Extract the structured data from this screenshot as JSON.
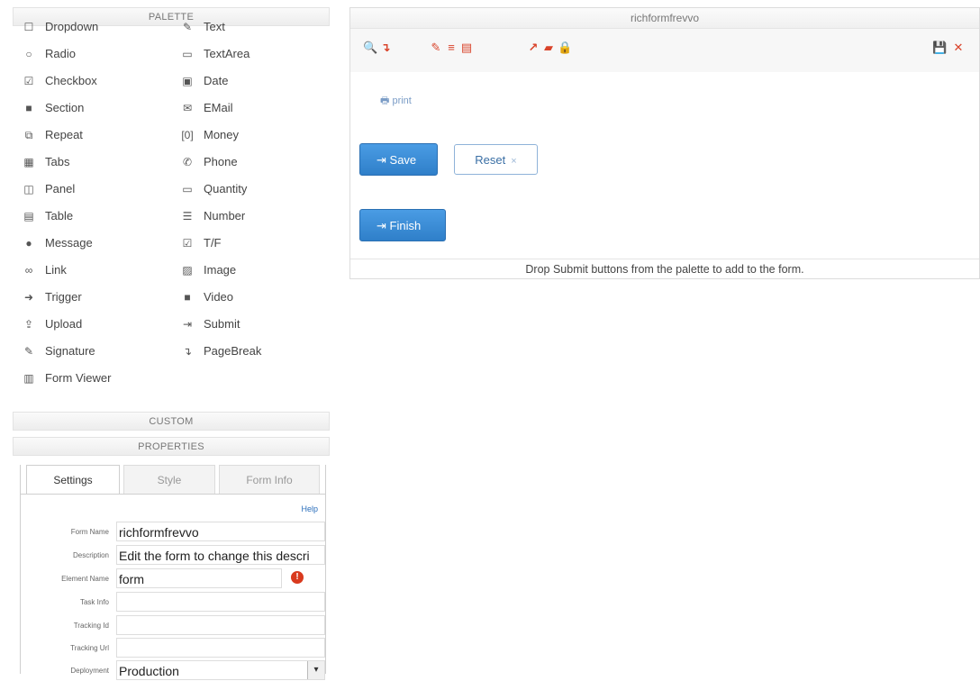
{
  "palette": {
    "header": "PALETTE",
    "left_items": [
      {
        "label": "Dropdown",
        "icon": "☐"
      },
      {
        "label": "Radio",
        "icon": "○"
      },
      {
        "label": "Checkbox",
        "icon": "☑"
      },
      {
        "label": "Section",
        "icon": "■"
      },
      {
        "label": "Repeat",
        "icon": "⧉"
      },
      {
        "label": "Tabs",
        "icon": "▦"
      },
      {
        "label": "Panel",
        "icon": "◫"
      },
      {
        "label": "Table",
        "icon": "▤"
      },
      {
        "label": "Message",
        "icon": "●"
      },
      {
        "label": "Link",
        "icon": "∞"
      },
      {
        "label": "Trigger",
        "icon": "➜"
      },
      {
        "label": "Upload",
        "icon": "⇪"
      },
      {
        "label": "Signature",
        "icon": "✎"
      },
      {
        "label": "Form Viewer",
        "icon": "▥"
      }
    ],
    "right_items": [
      {
        "label": "Text",
        "icon": "✎"
      },
      {
        "label": "TextArea",
        "icon": "▭"
      },
      {
        "label": "Date",
        "icon": "▣"
      },
      {
        "label": "EMail",
        "icon": "✉"
      },
      {
        "label": "Money",
        "icon": "[0]"
      },
      {
        "label": "Phone",
        "icon": "✆"
      },
      {
        "label": "Quantity",
        "icon": "▭"
      },
      {
        "label": "Number",
        "icon": "☰"
      },
      {
        "label": "T/F",
        "icon": "☑"
      },
      {
        "label": "Image",
        "icon": "▨"
      },
      {
        "label": "Video",
        "icon": "■"
      },
      {
        "label": "Submit",
        "icon": "⇥"
      },
      {
        "label": "PageBreak",
        "icon": "↴"
      }
    ]
  },
  "custom": {
    "header": "CUSTOM"
  },
  "properties": {
    "header": "PROPERTIES",
    "tabs": [
      "Settings",
      "Style",
      "Form Info"
    ],
    "help": "Help",
    "fields": [
      {
        "label": "Form Name",
        "value": "richformfrevvo"
      },
      {
        "label": "Description",
        "value": "Edit the form to change this descri"
      },
      {
        "label": "Element Name",
        "value": "form"
      },
      {
        "label": "Task Info",
        "value": ""
      },
      {
        "label": "Tracking Id",
        "value": ""
      },
      {
        "label": "Tracking Url",
        "value": ""
      },
      {
        "label": "Deployment",
        "value": "Production"
      }
    ],
    "info_icon": "!",
    "select_arrow": "▾"
  },
  "canvas": {
    "title": "richformfrevvo",
    "toolbar_icons": [
      "search-icon",
      "page-break-icon",
      "edit-icon",
      "list-icon",
      "document-icon",
      "external-link-icon",
      "book-icon",
      "lock-icon",
      "save-icon",
      "close-icon"
    ],
    "toolbar_glyphs": [
      "🔍",
      "↴",
      "✎",
      "≡",
      "▤",
      "↗",
      "▰",
      "🔒",
      "💾",
      "✕"
    ],
    "print_label": "print",
    "print_icon": "🖶",
    "save_button": "Save",
    "reset_button": "Reset",
    "reset_x": "×",
    "finish_button": "Finish",
    "submit_glyph": "⇥",
    "drop_note": "Drop Submit buttons from the palette to add to the form.",
    "accent_color": "#d9432a",
    "button_color": "#3a8bd6"
  }
}
